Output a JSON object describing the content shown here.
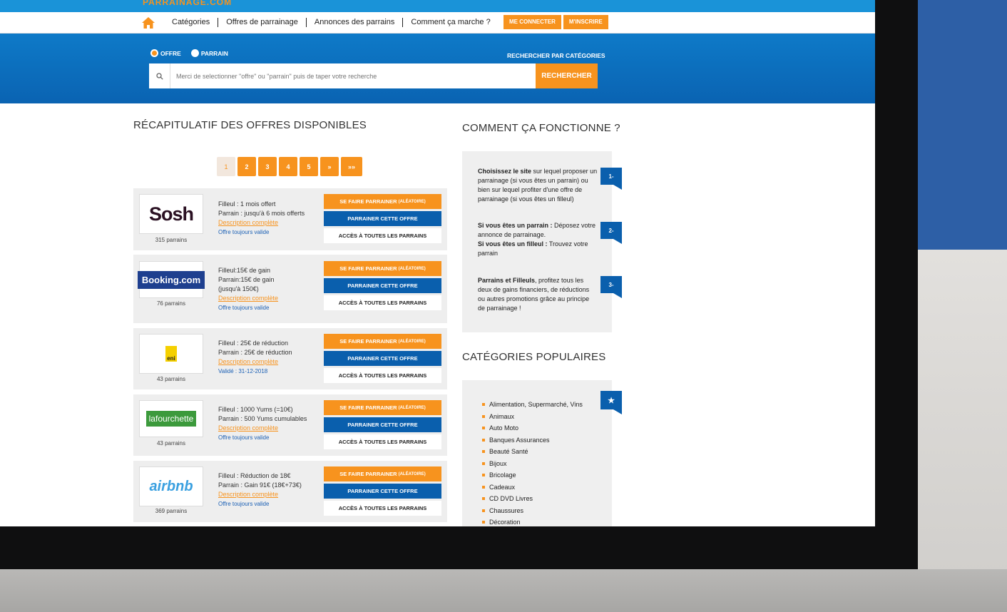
{
  "site": {
    "logo_text": "PARRAINAGE.COM"
  },
  "nav": {
    "links": [
      "Catégories",
      "Offres de parrainage",
      "Annonces des parrains",
      "Comment ça marche ?"
    ],
    "login": "ME CONNECTER",
    "register": "M'INSCRIRE"
  },
  "search": {
    "radio_offre": "OFFRE",
    "radio_parrain": "PARRAIN",
    "selected": "OFFRE",
    "categories_link": "RECHERCHER PAR CATÉGORIES",
    "placeholder": "Merci de selectionner \"offre\" ou \"parrain\" puis de taper votre recherche",
    "button": "RECHERCHER"
  },
  "offers_section": {
    "title": "RÉCAPITULATIF DES OFFRES DISPONIBLES",
    "pages": [
      "1",
      "2",
      "3",
      "4",
      "5",
      "»",
      "»»"
    ],
    "current_page": "1",
    "action_labels": {
      "parrainer": "SE FAIRE PARRAINER",
      "aleatoire": "(ALÉATOIRE)",
      "parrainer_offre": "PARRAINER CETTE OFFRE",
      "acces": "ACCÈS À TOUTES LES PARRAINS"
    },
    "offers": [
      {
        "brand": "Sosh",
        "lines": [
          "Filleul : 1 mois offert",
          "Parrain : jusqu'à 6 mois offerts"
        ],
        "desc": "Description complète",
        "validity": "Offre toujours valide",
        "parrains": "315 parrains"
      },
      {
        "brand": "Booking.com",
        "lines": [
          "Filleul:15€ de gain",
          "Parrain:15€ de gain",
          "(jusqu'à 150€)"
        ],
        "desc": "Description complète",
        "validity": "Offre toujours valide",
        "parrains": "76 parrains"
      },
      {
        "brand": "eni",
        "lines": [
          "Filleul : 25€ de réduction",
          "Parrain : 25€ de réduction"
        ],
        "desc": "Description complète",
        "validity": "Validé : 31-12-2018",
        "parrains": "43 parrains"
      },
      {
        "brand": "lafourchette",
        "lines": [
          "Filleul : 1000 Yums (=10€)",
          "Parrain : 500 Yums cumulables"
        ],
        "desc": "Description complète",
        "validity": "Offre toujours valide",
        "parrains": "43 parrains"
      },
      {
        "brand": "airbnb",
        "lines": [
          "Filleul : Réduction de 18€",
          "Parrain : Gain 91€ (18€+73€)"
        ],
        "desc": "Description complète",
        "validity": "Offre toujours valide",
        "parrains": "369 parrains"
      }
    ]
  },
  "how_section": {
    "title": "COMMENT ÇA FONCTIONNE ?",
    "steps": [
      {
        "num": "1-",
        "bold": "Choisissez le site",
        "text": " sur lequel proposer un parrainage (si vous êtes un parrain) ou bien sur lequel profiter d'une offre de parrainage (si vous êtes un filleul)"
      },
      {
        "num": "2-",
        "bold": "Si vous êtes un parrain :",
        "text": " Déposez votre annonce de parrainage.",
        "bold2": "Si vous êtes un filleul :",
        "text2": " Trouvez votre parrain"
      },
      {
        "num": "3-",
        "bold": "Parrains et Filleuls",
        "text": ", profitez tous les deux de gains financiers, de réductions ou autres promotions grâce au principe de parrainage !"
      }
    ]
  },
  "categories_section": {
    "title": "CATÉGORIES POPULAIRES",
    "flag_icon": "★",
    "items": [
      "Alimentation, Supermarché, Vins",
      "Animaux",
      "Auto Moto",
      "Banques Assurances",
      "Beauté Santé",
      "Bijoux",
      "Bricolage",
      "Cadeaux",
      "CD DVD Livres",
      "Chaussures",
      "Décoration"
    ]
  },
  "colors": {
    "orange": "#f7931e",
    "blue": "#0a5fad",
    "header_blue": "#1a93d8"
  }
}
